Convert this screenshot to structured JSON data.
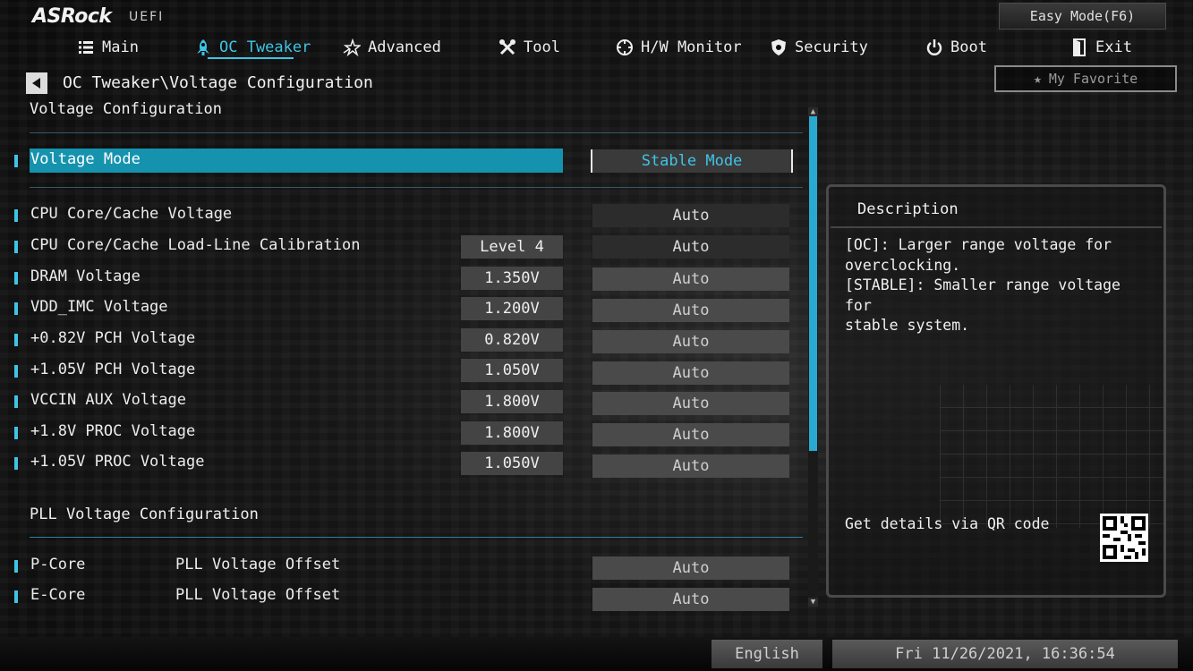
{
  "brand": {
    "logo": "ASRock",
    "uefi": "UEFI"
  },
  "easy_mode_label": "Easy Mode(F6)",
  "my_favorite_label": "My Favorite",
  "tabs": [
    {
      "label": "Main",
      "icon": "list-icon",
      "active": false
    },
    {
      "label": "OC Tweaker",
      "icon": "rocket-icon",
      "active": true
    },
    {
      "label": "Advanced",
      "icon": "star-icon",
      "active": false
    },
    {
      "label": "Tool",
      "icon": "tools-icon",
      "active": false
    },
    {
      "label": "H/W Monitor",
      "icon": "monitor-icon",
      "active": false
    },
    {
      "label": "Security",
      "icon": "shield-icon",
      "active": false
    },
    {
      "label": "Boot",
      "icon": "power-icon",
      "active": false
    },
    {
      "label": "Exit",
      "icon": "exit-door-icon",
      "active": false
    }
  ],
  "breadcrumb": "OC Tweaker\\Voltage Configuration",
  "section_title": "Voltage Configuration",
  "voltage_mode": {
    "label": "Voltage Mode",
    "option": "Stable Mode"
  },
  "rows": [
    {
      "label": "CPU Core/Cache Voltage",
      "value": "",
      "option": "Auto"
    },
    {
      "label": "CPU Core/Cache Load-Line Calibration",
      "value": "Level 4",
      "option": "Auto"
    },
    {
      "label": "DRAM Voltage",
      "value": "1.350V",
      "option": "Auto"
    },
    {
      "label": "VDD_IMC Voltage",
      "value": "1.200V",
      "option": "Auto"
    },
    {
      "label": "+0.82V PCH Voltage",
      "value": "0.820V",
      "option": "Auto"
    },
    {
      "label": "+1.05V PCH Voltage",
      "value": "1.050V",
      "option": "Auto"
    },
    {
      "label": "VCCIN AUX Voltage",
      "value": "1.800V",
      "option": "Auto"
    },
    {
      "label": "+1.8V PROC Voltage",
      "value": "1.800V",
      "option": "Auto"
    },
    {
      "label": "+1.05V PROC Voltage",
      "value": "1.050V",
      "option": "Auto"
    }
  ],
  "pll_title": "PLL Voltage Configuration",
  "pll_rows": [
    {
      "label": "P-Core",
      "sub": "PLL Voltage Offset",
      "option": "Auto"
    },
    {
      "label": "E-Core",
      "sub": "PLL Voltage Offset",
      "option": "Auto"
    }
  ],
  "description": {
    "title": "Description",
    "text": "[OC]: Larger range voltage for\noverclocking.\n[STABLE]: Smaller range voltage for\nstable system.",
    "qr_text": "Get details via QR code"
  },
  "footer": {
    "language": "English",
    "datetime": "Fri 11/26/2021, 16:36:54"
  },
  "colors": {
    "accent": "#3fc4e6",
    "selected_row": "#1593ae"
  }
}
